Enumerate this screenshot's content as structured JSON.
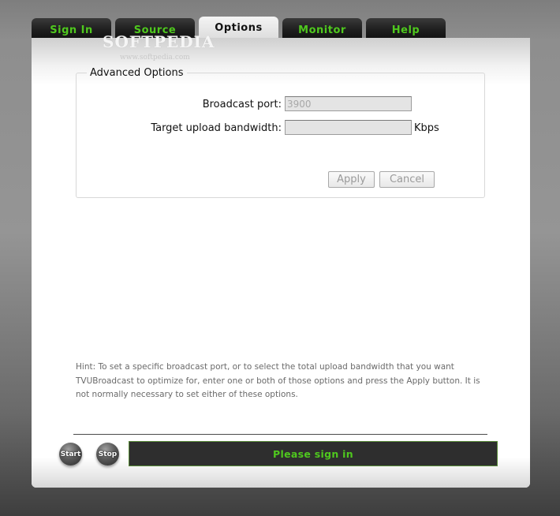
{
  "tabs": [
    {
      "label": "Sign In",
      "active": false
    },
    {
      "label": "Source",
      "active": false
    },
    {
      "label": "Options",
      "active": true
    },
    {
      "label": "Monitor",
      "active": false
    },
    {
      "label": "Help",
      "active": false
    }
  ],
  "watermark": {
    "logo": "SOFTPEDIA",
    "url": "www.softpedia.com"
  },
  "advanced": {
    "legend": "Advanced Options",
    "broadcast_port_label": "Broadcast port:",
    "broadcast_port_value": "3900",
    "bandwidth_label": "Target upload bandwidth:",
    "bandwidth_value": "",
    "bandwidth_unit": "Kbps",
    "apply_label": "Apply",
    "cancel_label": "Cancel"
  },
  "hint": "Hint: To set a specific broadcast port, or to select the total upload bandwidth that you want TVUBroadcast to optimize for, enter one or both of those options and press the Apply button. It is not normally necessary to set either of these options.",
  "controls": {
    "start_label": "Start",
    "stop_label": "Stop"
  },
  "status": {
    "text": "Please sign in"
  },
  "colors": {
    "accent_green": "#4fc81e",
    "tab_dark": "#1c1c1c",
    "status_bg": "#2e2e2e"
  }
}
